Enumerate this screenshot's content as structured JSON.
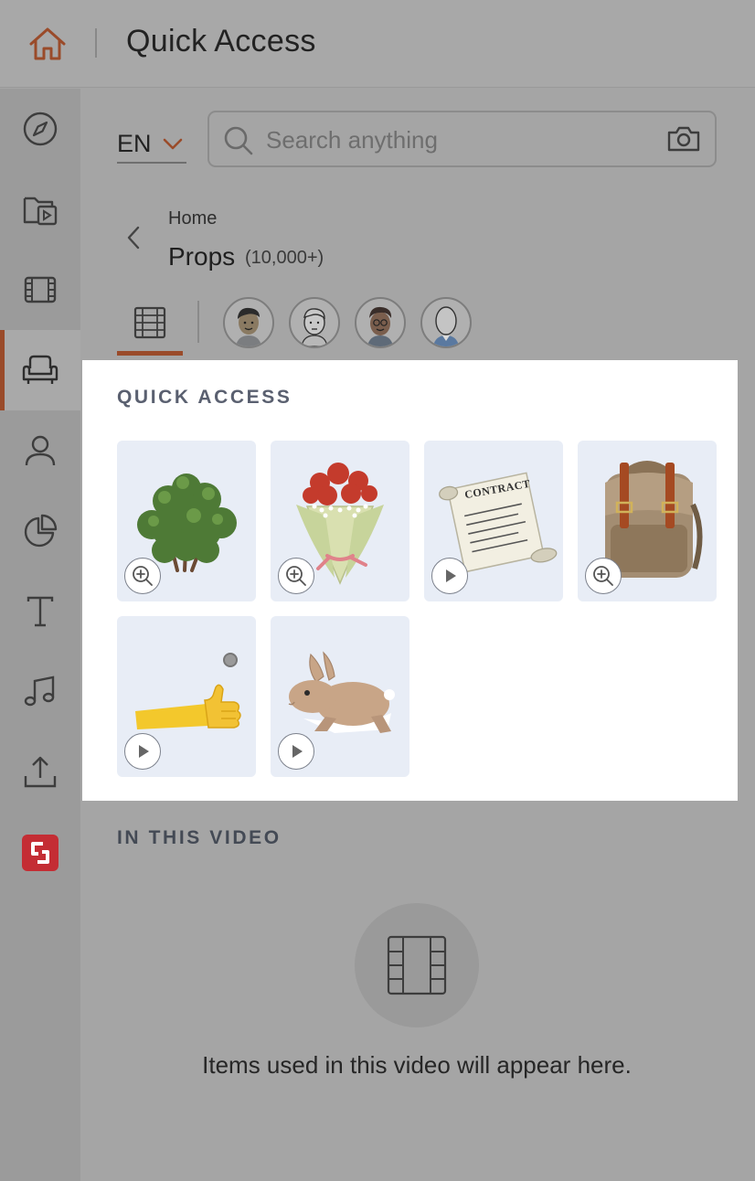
{
  "topbar": {
    "title": "Quick Access",
    "home_icon": "home-icon"
  },
  "rail": {
    "items": [
      {
        "name": "explore",
        "icon": "compass-icon"
      },
      {
        "name": "media",
        "icon": "folder-video-icon"
      },
      {
        "name": "scenes",
        "icon": "film-icon"
      },
      {
        "name": "props",
        "icon": "armchair-icon",
        "active": true
      },
      {
        "name": "characters",
        "icon": "person-icon"
      },
      {
        "name": "charts",
        "icon": "pie-chart-icon"
      },
      {
        "name": "text",
        "icon": "text-icon"
      },
      {
        "name": "audio",
        "icon": "music-note-icon"
      },
      {
        "name": "upload",
        "icon": "upload-icon"
      },
      {
        "name": "brand",
        "icon": "brand-logo-icon"
      }
    ]
  },
  "language": {
    "value": "EN"
  },
  "search": {
    "placeholder": "Search anything"
  },
  "breadcrumb": {
    "parent": "Home",
    "title": "Props",
    "count": "(10,000+)"
  },
  "quick_access": {
    "heading": "QUICK ACCESS",
    "items": [
      {
        "name": "bush",
        "action": "zoom"
      },
      {
        "name": "flower-bouquet",
        "action": "zoom"
      },
      {
        "name": "contract-scroll",
        "label": "CONTRACT",
        "action": "play"
      },
      {
        "name": "backpack",
        "action": "zoom"
      },
      {
        "name": "thumbs-up-arm",
        "action": "play"
      },
      {
        "name": "rabbit",
        "action": "play"
      }
    ]
  },
  "in_this_video": {
    "heading": "IN THIS VIDEO",
    "empty_message": "Items used in this video will appear here."
  },
  "colors": {
    "accent": "#9a4b2a",
    "overlay": "#a5a5a5",
    "tile_bg": "#e8edf6",
    "brand": "#c42d34"
  }
}
